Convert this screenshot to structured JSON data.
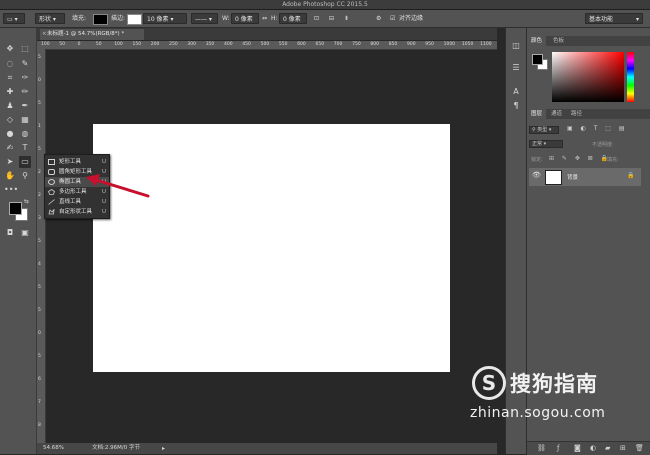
{
  "window": {
    "title": "Adobe Photoshop CC 2015.5"
  },
  "options_bar": {
    "mode": "形状",
    "fill_label": "填充:",
    "stroke_label": "描边:",
    "stroke_width": "10 像素",
    "w_label": "W:",
    "w_value": "0 像素",
    "h_label": "H:",
    "h_value": "0 像素",
    "align_edges": "对齐边缘",
    "workspace": "基本功能"
  },
  "document": {
    "tab_label": "未标题-1 @ 54.7%(RGB/8*) *",
    "zoom": "54.68%",
    "doc_info": "文档:2.96M/0 字节"
  },
  "ruler": {
    "top": [
      "100",
      "50",
      "0",
      "50",
      "100",
      "150",
      "200",
      "250",
      "300",
      "350",
      "400",
      "450",
      "500",
      "550",
      "600",
      "650",
      "700",
      "750",
      "800",
      "850",
      "900",
      "950",
      "1000",
      "1050",
      "1100"
    ],
    "left": [
      "5",
      "0",
      "5",
      "1",
      "5",
      "2",
      "2",
      "3",
      "5",
      "4",
      "5",
      "5",
      "0",
      "5",
      "6",
      "7",
      "8"
    ]
  },
  "flyout_menu": {
    "items": [
      {
        "label": "矩形工具",
        "key": "U",
        "icon": "rectangle-shape-icon"
      },
      {
        "label": "圆角矩形工具",
        "key": "U",
        "icon": "rounded-rectangle-icon"
      },
      {
        "label": "椭圆工具",
        "key": "U",
        "icon": "ellipse-icon",
        "highlighted": true
      },
      {
        "label": "多边形工具",
        "key": "U",
        "icon": "polygon-icon"
      },
      {
        "label": "直线工具",
        "key": "U",
        "icon": "line-icon"
      },
      {
        "label": "自定形状工具",
        "key": "U",
        "icon": "custom-shape-icon"
      }
    ]
  },
  "panels": {
    "color_tabs": [
      "颜色",
      "色板"
    ],
    "layer_tabs": [
      "图层",
      "通道",
      "路径"
    ],
    "filter_kind": "类型",
    "blend_mode": "正常",
    "opacity_label": "不透明度:",
    "lock_label": "锁定:",
    "fill_label": "填充:",
    "layer_name": "背景"
  },
  "watermark": {
    "brand": "搜狗指南",
    "url": "zhinan.sogou.com"
  },
  "colors": {
    "annotation_arrow": "#c8102e",
    "foreground": "#000000",
    "background": "#ffffff"
  }
}
